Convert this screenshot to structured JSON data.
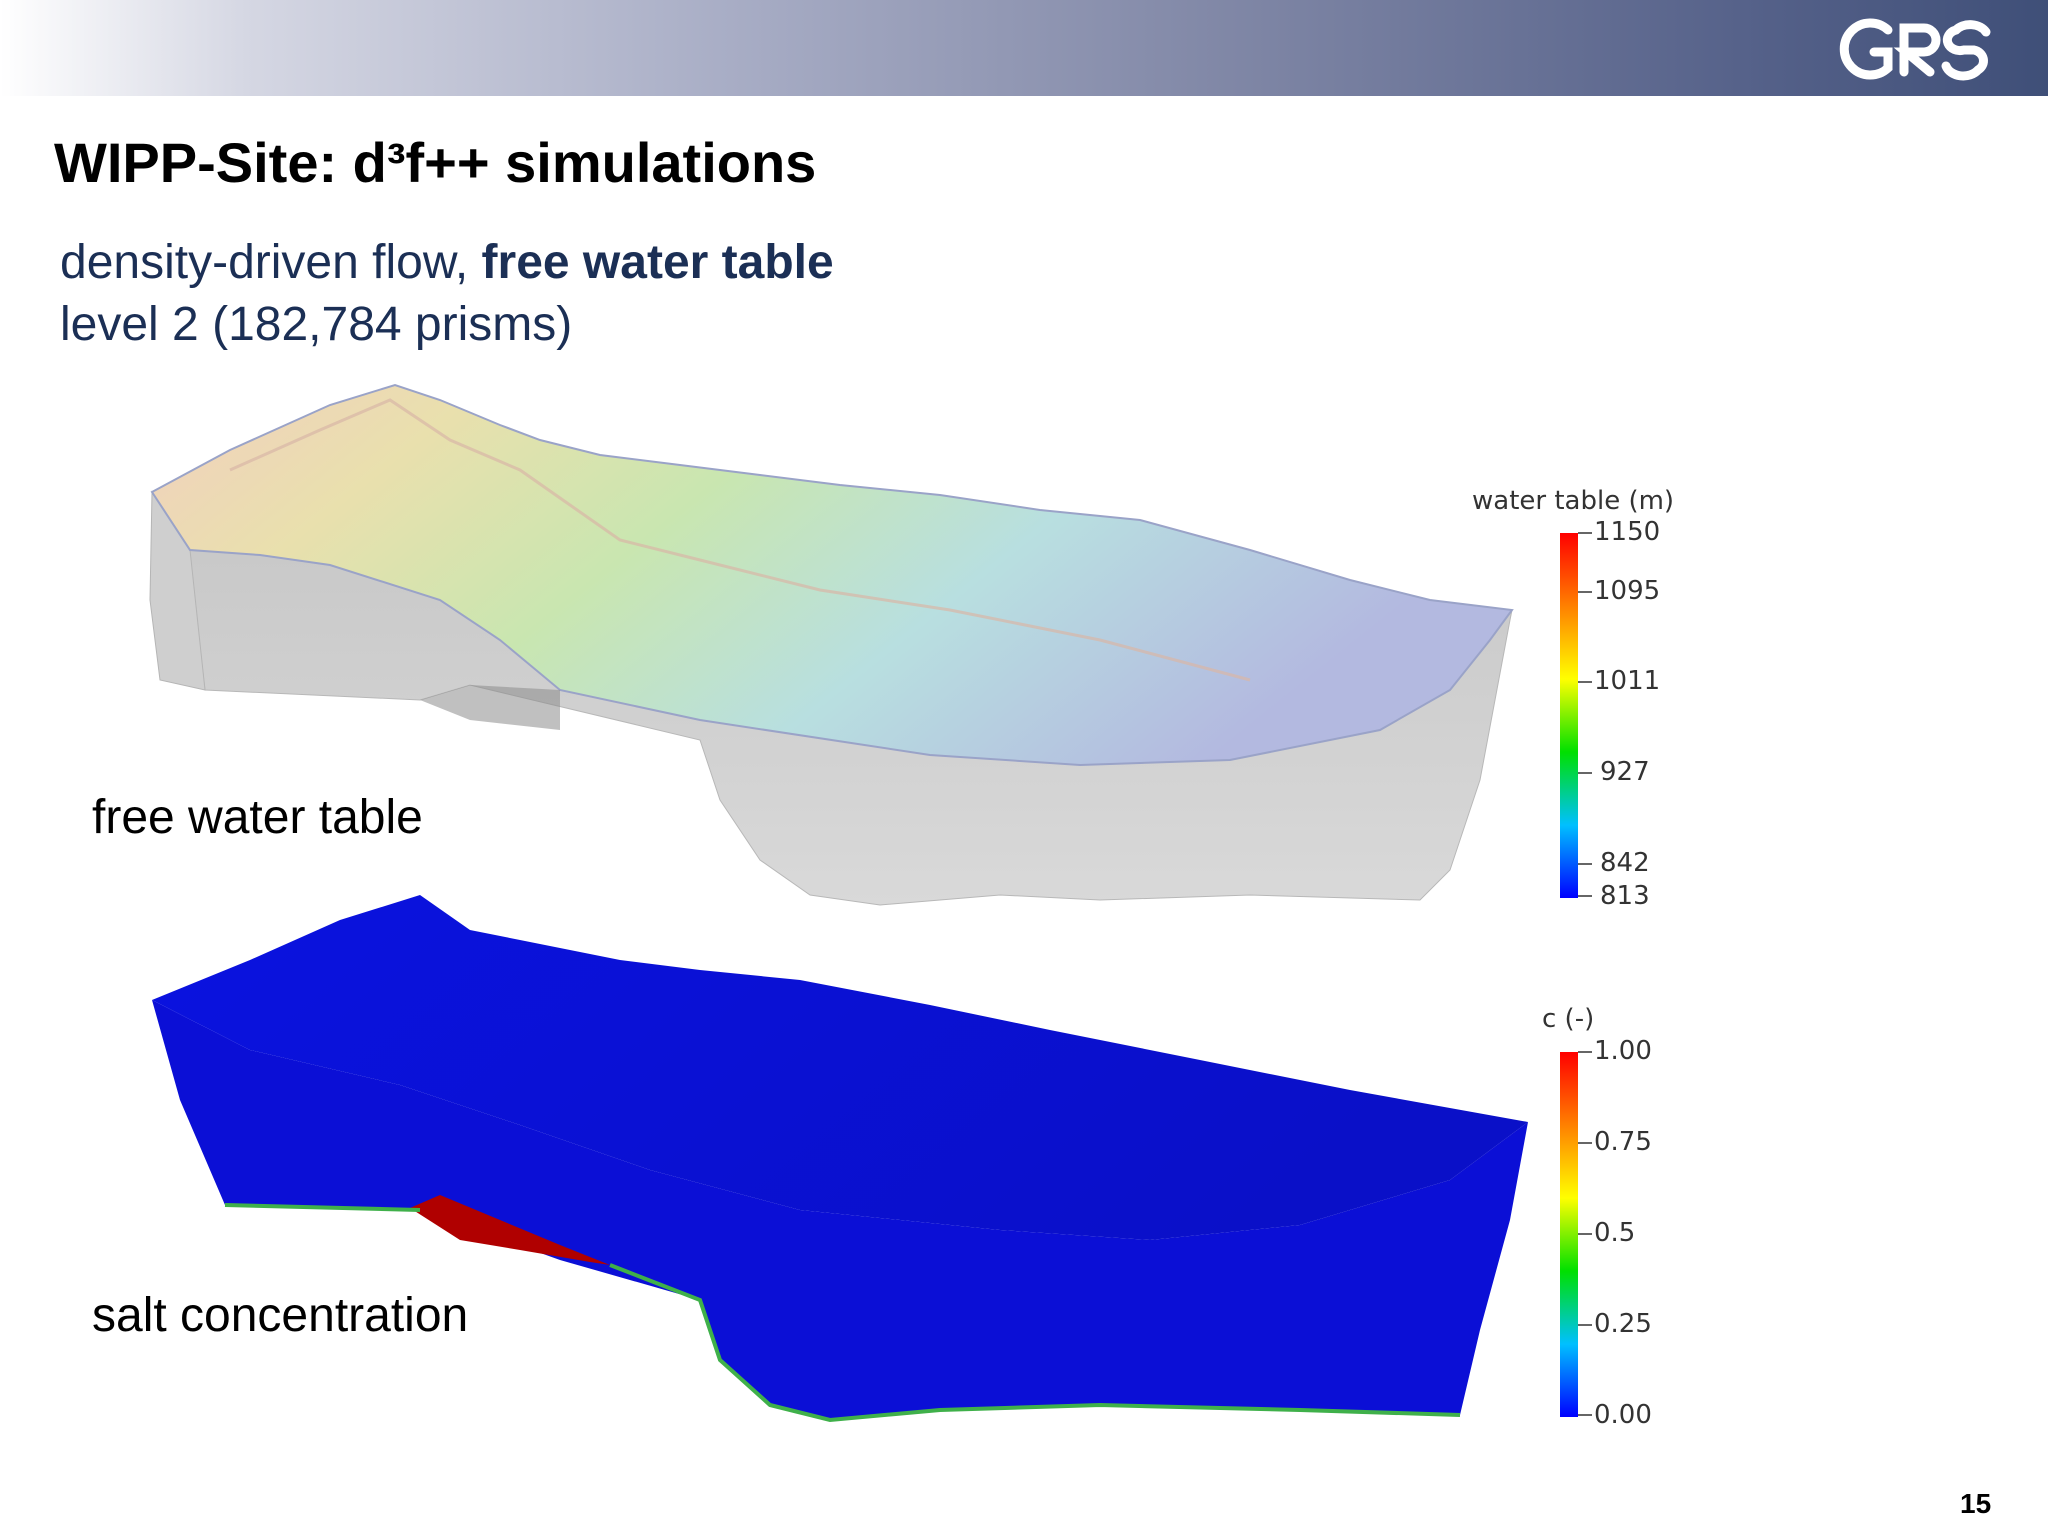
{
  "header": {
    "logo_text": "GRS",
    "colors": {
      "band_start": "#ffffff",
      "band_end": "#3f4f78",
      "logo": "#ffffff"
    }
  },
  "slide": {
    "title": "WIPP-Site: d³f++ simulations",
    "subtitle_line1_plain": "density-driven flow, ",
    "subtitle_line1_bold": "free water table",
    "subtitle_line2": "level 2 (182,784 prisms)",
    "page_number": "15"
  },
  "panels": {
    "top": {
      "label": "free water table",
      "legend": {
        "title": "water table (m)",
        "ticks": [
          "1150",
          "1095",
          "1011",
          "927",
          "842",
          "813"
        ],
        "colorscale": [
          "#0000ff",
          "#00c0ff",
          "#00e000",
          "#ffff00",
          "#ff8000",
          "#ff0000"
        ]
      }
    },
    "bottom": {
      "label": "salt concentration",
      "legend": {
        "title": "c (-)",
        "ticks": [
          "1.00",
          "0.75",
          "0.5",
          "0.25",
          "0.00"
        ],
        "colorscale": [
          "#0000ff",
          "#00c0ff",
          "#00e000",
          "#ffff00",
          "#ff8000",
          "#ff0000"
        ]
      }
    }
  }
}
